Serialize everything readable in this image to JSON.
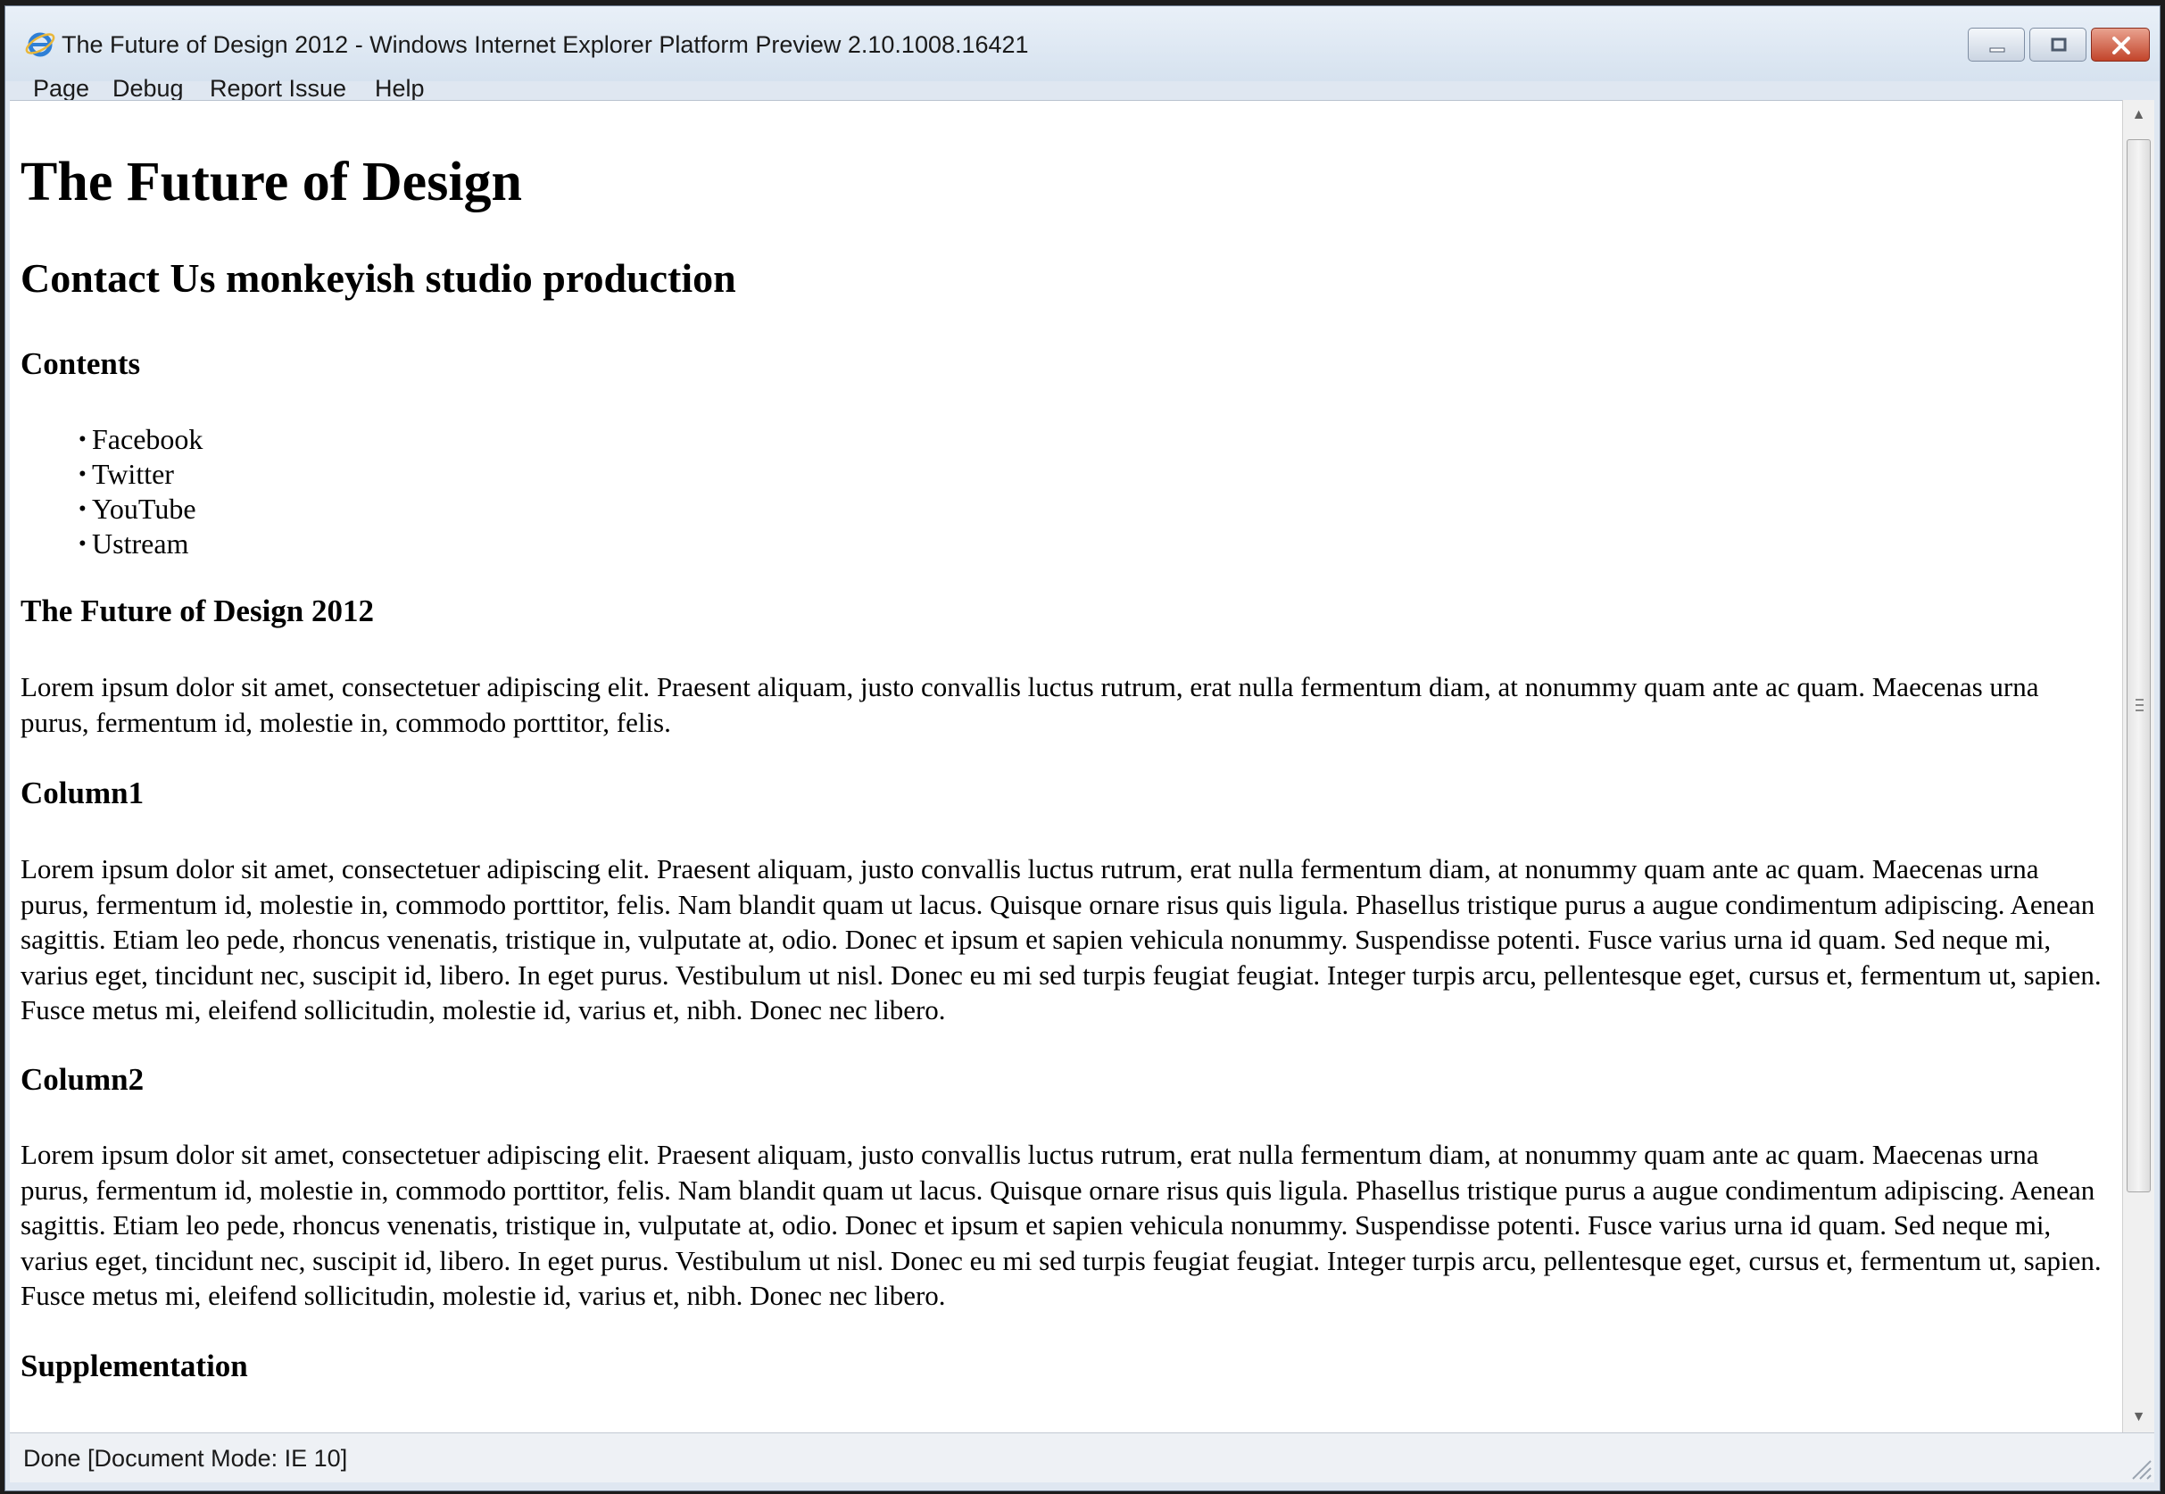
{
  "window": {
    "title": "The Future of Design 2012 - Windows Internet Explorer Platform Preview 2.10.1008.16421",
    "icons": [
      "ie-logo-icon",
      "minimize-icon",
      "maximize-icon",
      "close-icon"
    ]
  },
  "menu": {
    "items": [
      {
        "label": "Page"
      },
      {
        "label": "Debug"
      },
      {
        "label": "Report Issue"
      },
      {
        "label": "Help"
      }
    ]
  },
  "page": {
    "heading1": "The Future of Design",
    "heading2": "Contact Us monkeyish studio production",
    "contents_heading": "Contents",
    "contents": [
      {
        "label": "Facebook"
      },
      {
        "label": "Twitter"
      },
      {
        "label": "YouTube"
      },
      {
        "label": "Ustream"
      }
    ],
    "bullet": "•",
    "section_2012": {
      "heading": "The Future of Design 2012",
      "text": "Lorem ipsum dolor sit amet, consectetuer adipiscing elit. Praesent aliquam, justo convallis luctus rutrum, erat nulla fermentum diam, at nonummy quam ante ac quam. Maecenas urna purus, fermentum id, molestie in, commodo porttitor, felis."
    },
    "column1": {
      "heading": "Column1",
      "text": "Lorem ipsum dolor sit amet, consectetuer adipiscing elit. Praesent aliquam, justo convallis luctus rutrum, erat nulla fermentum diam, at nonummy quam ante ac quam. Maecenas urna purus, fermentum id, molestie in, commodo porttitor, felis. Nam blandit quam ut lacus. Quisque ornare risus quis ligula. Phasellus tristique purus a augue condimentum adipiscing. Aenean sagittis. Etiam leo pede, rhoncus venenatis, tristique in, vulputate at, odio. Donec et ipsum et sapien vehicula nonummy. Suspendisse potenti. Fusce varius urna id quam. Sed neque mi, varius eget, tincidunt nec, suscipit id, libero. In eget purus. Vestibulum ut nisl. Donec eu mi sed turpis feugiat feugiat. Integer turpis arcu, pellentesque eget, cursus et, fermentum ut, sapien. Fusce metus mi, eleifend sollicitudin, molestie id, varius et, nibh. Donec nec libero."
    },
    "column2": {
      "heading": "Column2",
      "text": "Lorem ipsum dolor sit amet, consectetuer adipiscing elit. Praesent aliquam, justo convallis luctus rutrum, erat nulla fermentum diam, at nonummy quam ante ac quam. Maecenas urna purus, fermentum id, molestie in, commodo porttitor, felis. Nam blandit quam ut lacus. Quisque ornare risus quis ligula. Phasellus tristique purus a augue condimentum adipiscing. Aenean sagittis. Etiam leo pede, rhoncus venenatis, tristique in, vulputate at, odio. Donec et ipsum et sapien vehicula nonummy. Suspendisse potenti. Fusce varius urna id quam. Sed neque mi, varius eget, tincidunt nec, suscipit id, libero. In eget purus. Vestibulum ut nisl. Donec eu mi sed turpis feugiat feugiat. Integer turpis arcu, pellentesque eget, cursus et, fermentum ut, sapien. Fusce metus mi, eleifend sollicitudin, molestie id, varius et, nibh. Donec nec libero."
    },
    "supplementation_heading": "Supplementation"
  },
  "scrollbar": {
    "up_arrow": "▲",
    "down_arrow": "▼"
  },
  "status": {
    "text": "Done [Document Mode: IE 10]"
  },
  "colors": {
    "titlebar": "#dfe7f1",
    "close_button": "#c2442a",
    "page_background": "#ffffff"
  }
}
